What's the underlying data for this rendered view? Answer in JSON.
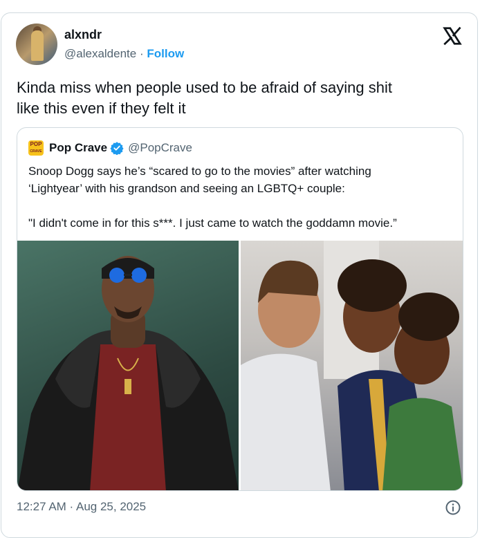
{
  "author": {
    "name": "alxndr",
    "handle": "@alexaldente",
    "separator": "·",
    "follow_label": "Follow",
    "avatar_icon": "profile-photo"
  },
  "tweet": {
    "line1": "Kinda miss when people used to be afraid of saying shit",
    "line2": "like this even if they felt it"
  },
  "quoted": {
    "logo_text_top": "POP",
    "logo_text_bottom": "CRAVE",
    "name": "Pop Crave",
    "handle": "@PopCrave",
    "verified_icon": "verified-badge-icon",
    "line1": "Snoop Dogg says he’s “scared to go to the movies” after watching",
    "line2": "‘Lightyear’ with his grandson and seeing an LGBTQ+ couple:",
    "line3": "\"I didn't come in for this s***. I just came to watch the goddamn movie.”",
    "images": [
      "snoop-dogg-photo",
      "lightyear-animated-still"
    ]
  },
  "footer": {
    "timestamp": "12:27 AM · Aug 25, 2025",
    "info_icon": "info-icon"
  },
  "colors": {
    "link": "#1d9bf0",
    "secondary_text": "#536471",
    "border": "#cfd9de"
  }
}
